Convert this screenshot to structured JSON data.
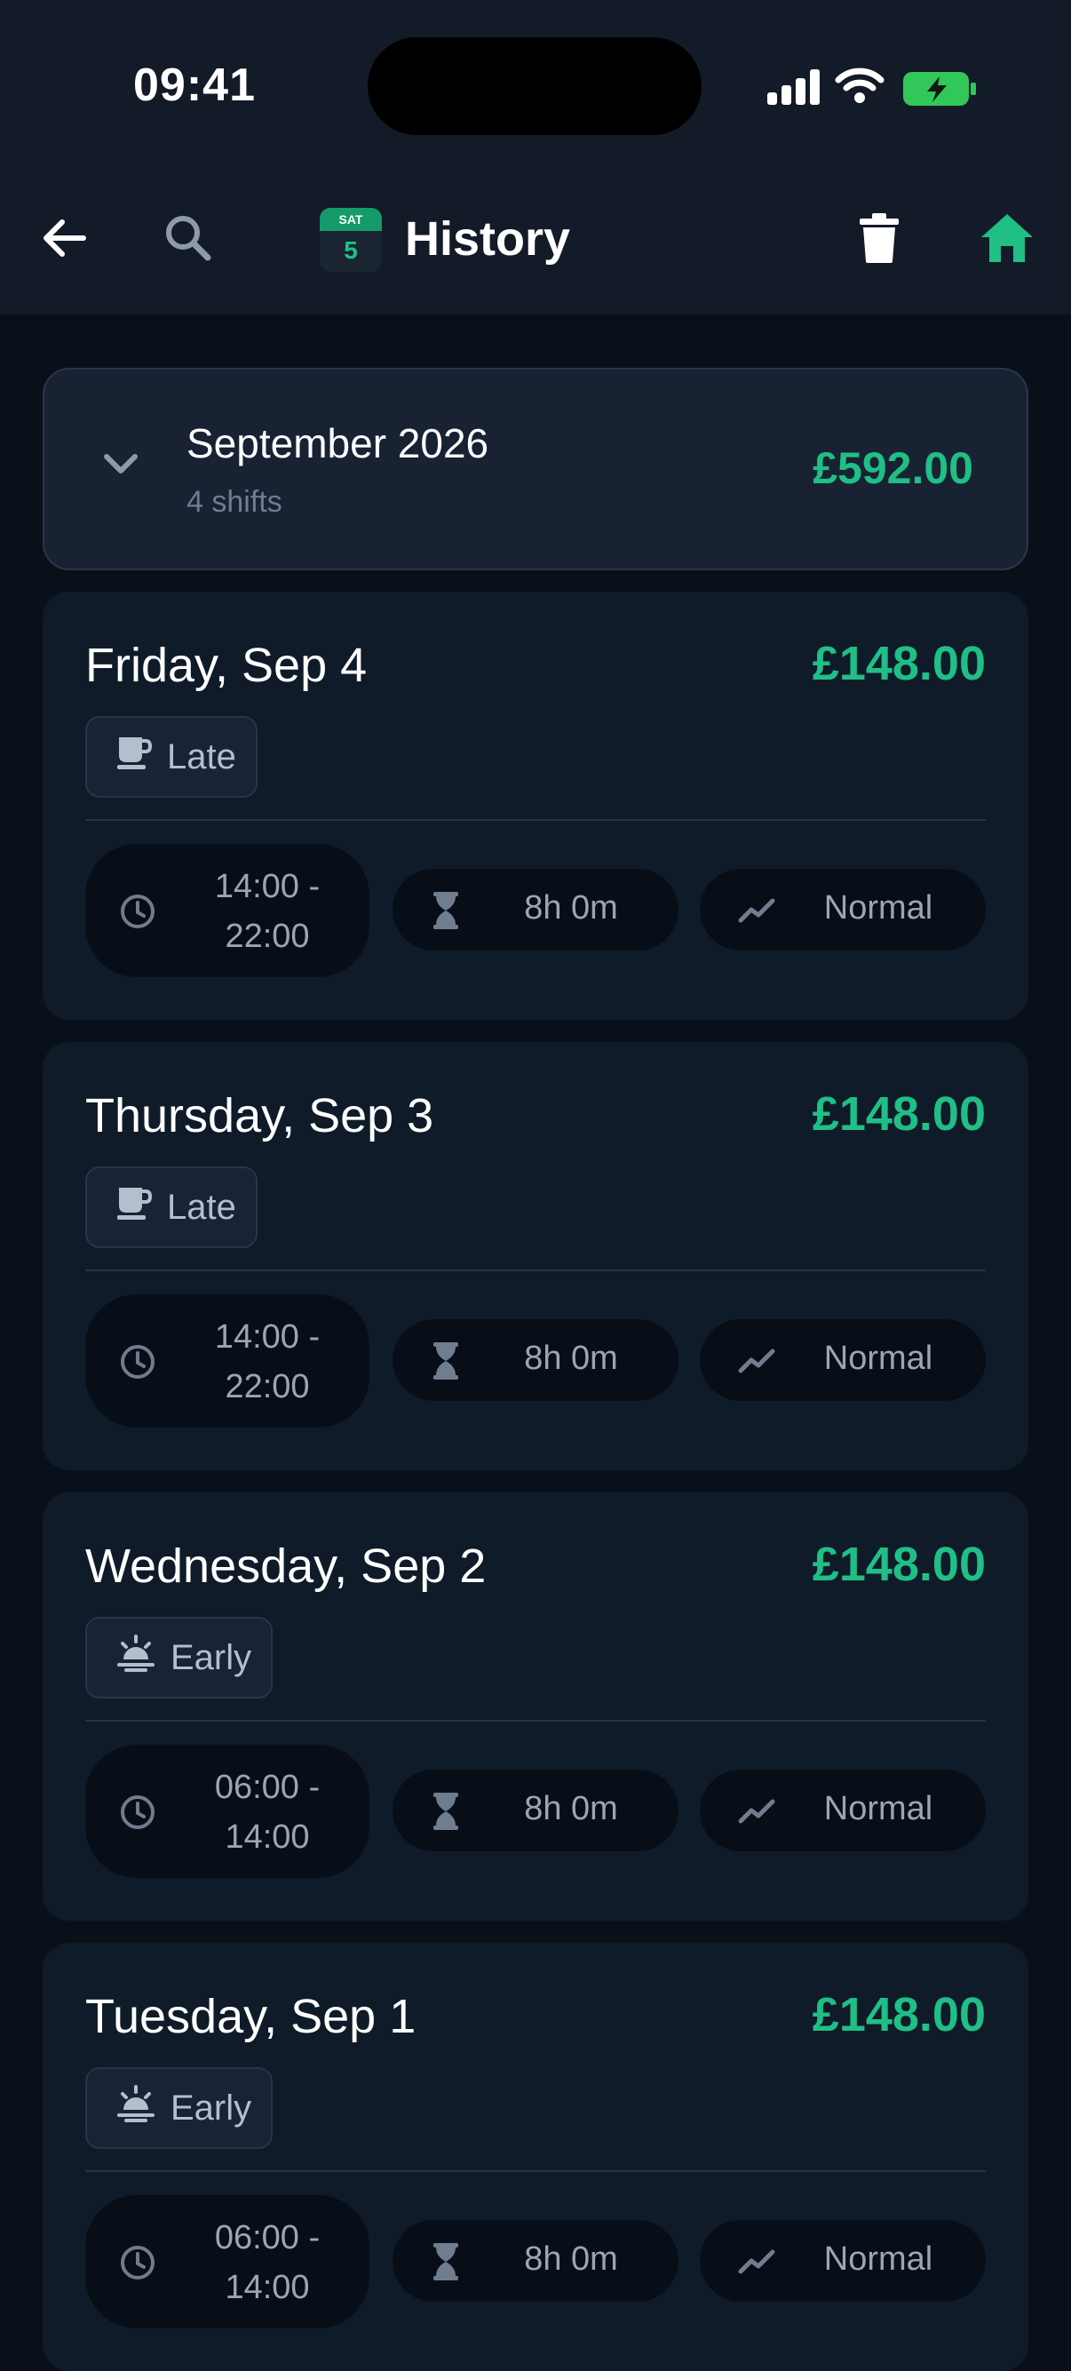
{
  "status_bar": {
    "time": "09:41"
  },
  "header": {
    "calendar_day": "SAT",
    "calendar_date": "5",
    "title": "History"
  },
  "month": {
    "title": "September 2026",
    "subtitle": "4 shifts",
    "total": "£592.00"
  },
  "shifts": [
    {
      "date": "Friday, Sep 4",
      "amount": "£148.00",
      "type": "Late",
      "time_start": "14:00 -",
      "time_end": "22:00",
      "duration": "8h 0m",
      "rate": "Normal"
    },
    {
      "date": "Thursday, Sep 3",
      "amount": "£148.00",
      "type": "Late",
      "time_start": "14:00 -",
      "time_end": "22:00",
      "duration": "8h 0m",
      "rate": "Normal"
    },
    {
      "date": "Wednesday, Sep 2",
      "amount": "£148.00",
      "type": "Early",
      "time_start": "06:00 -",
      "time_end": "14:00",
      "duration": "8h 0m",
      "rate": "Normal"
    },
    {
      "date": "Tuesday, Sep 1",
      "amount": "£148.00",
      "type": "Early",
      "time_start": "06:00 -",
      "time_end": "14:00",
      "duration": "8h 0m",
      "rate": "Normal"
    }
  ],
  "icons": {
    "back": "arrow-left-icon",
    "search": "search-icon",
    "trash": "trash-icon",
    "home": "home-icon",
    "late": "coffee-cup-icon",
    "early": "sunrise-icon",
    "time": "clock-icon",
    "duration": "hourglass-icon",
    "rate": "trend-icon"
  },
  "colors": {
    "accent": "#1fbf86",
    "background": "#0a101a",
    "card": "#101b29",
    "app_bar": "#121b27"
  }
}
